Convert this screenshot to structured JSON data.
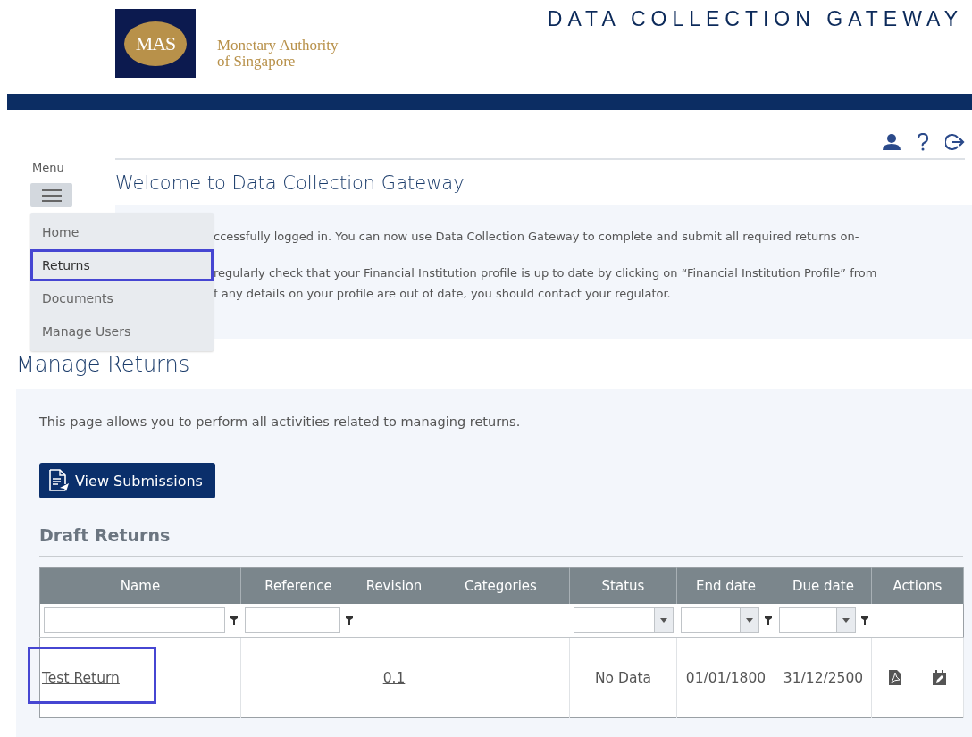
{
  "header": {
    "logo_text": "MAS",
    "org_name_line1": "Monetary Authority",
    "org_name_line2": "of Singapore",
    "title": "DATA COLLECTION GATEWAY"
  },
  "menu": {
    "label": "Menu",
    "expanded": true,
    "items": [
      {
        "label": "Home",
        "highlighted": false
      },
      {
        "label": "Returns",
        "highlighted": true
      },
      {
        "label": "Documents",
        "highlighted": false
      },
      {
        "label": "Manage Users",
        "highlighted": false
      }
    ]
  },
  "welcome": {
    "title": "Welcome to Data Collection Gateway",
    "paragraphs": [
      {
        "lines": [
          "ccessfully logged in. You can now use Data Collection Gateway to complete and submit all required returns on-"
        ]
      },
      {
        "lines": [
          "regularly check that your Financial Institution profile is up to date by clicking on “Financial Institution Profile” from",
          "f any details on your profile are out of date, you should contact your regulator."
        ]
      }
    ]
  },
  "manage_returns": {
    "title": "Manage Returns",
    "description": "This page allows you to perform all activities related to managing returns.",
    "button": "View Submissions",
    "section_title": "Draft Returns",
    "table": {
      "columns": [
        {
          "label": "Name"
        },
        {
          "label": "Reference"
        },
        {
          "label": "Revision"
        },
        {
          "label": "Categories"
        },
        {
          "label": "Status"
        },
        {
          "label": "End date"
        },
        {
          "label": "Due date"
        },
        {
          "label": "Actions"
        }
      ],
      "filters": [
        {
          "kind": "text"
        },
        {
          "kind": "text"
        },
        {
          "kind": "none"
        },
        {
          "kind": "none"
        },
        {
          "kind": "select"
        },
        {
          "kind": "select_funnel"
        },
        {
          "kind": "select_funnel"
        },
        {
          "kind": "none"
        }
      ],
      "rows": [
        {
          "name": "Test Return",
          "name_highlighted": true,
          "revision": "0.1",
          "status": "No Data",
          "end_date": "01/01/1800",
          "due_date": "31/12/2500"
        }
      ]
    }
  }
}
